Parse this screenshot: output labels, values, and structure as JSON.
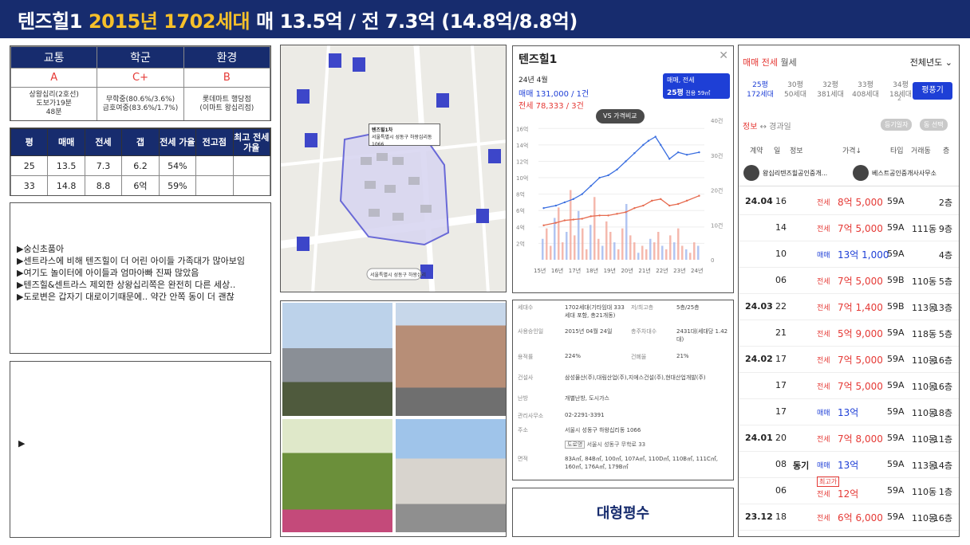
{
  "header": {
    "name": "텐즈힐1",
    "year_units": "2015년 1702세대",
    "prices": "매 13.5억 / 전 7.3억 (14.8억/8.8억)"
  },
  "location": {
    "headers": [
      "교통",
      "학군",
      "환경"
    ],
    "grades": [
      "A",
      "C+",
      "B"
    ],
    "details": [
      [
        "상왕십리(2호선)",
        "도보가19분",
        "48분"
      ],
      [
        "무학중(80.6%/3.6%)",
        "금호여중(83.6%/1.7%)"
      ],
      [
        "롯데마트 행당점",
        "(이마트 왕십리점)"
      ]
    ]
  },
  "price_table": {
    "headers": [
      "평",
      "매매",
      "전세",
      "갭",
      "전세 가율",
      "전고점",
      "최고 전세가율"
    ],
    "rows": [
      [
        "25",
        "13.5",
        "7.3",
        "6.2",
        "54%",
        "",
        ""
      ],
      [
        "33",
        "14.8",
        "8.8",
        "6억",
        "59%",
        "",
        ""
      ]
    ]
  },
  "notes": [
    "▶숭신초품아",
    "▶센트라스에 비해 텐즈힐이 더 어린 아이들 가족대가 많아보임",
    "▶여기도 놀이터에 아이들과 엄마아빠 진짜 많았음",
    "▶텐즈힐&센트라스 제외한 상왕십리쪽은 완전히 다른 세상..",
    "▶도로변은 갑자기 대로이기때문에.. 약간 안쪽 동이 더 괜찮"
  ],
  "notes2": [
    "▶"
  ],
  "map": {
    "callout_title": "텐즈힐1차",
    "callout_addr": "서울특별시 성동구 하왕십리동 1066",
    "footer": "서울특별시 성동구 하왕십리"
  },
  "chart_panel": {
    "title": "텐즈힐1",
    "date": "24년 4월",
    "sale_line": "매매 131,000 / 1건",
    "rent_line": "전세 78,333 / 3건",
    "toggle": "매매, 전세",
    "size_badge": "25평",
    "size_sub": "전용 59㎡",
    "compare_button": "VS 가격비교",
    "close_glyph": "✕"
  },
  "chart_data": {
    "type": "line",
    "x_ticks": [
      "15년",
      "16년",
      "17년",
      "18년",
      "19년",
      "20년",
      "21년",
      "22년",
      "23년",
      "24년"
    ],
    "y_left_ticks": [
      "16억",
      "14억",
      "12억",
      "10억",
      "8억",
      "6억",
      "4억",
      "2억"
    ],
    "y_right_ticks": [
      "40건",
      "30건",
      "20건",
      "10건",
      "0"
    ],
    "series": [
      {
        "name": "매매",
        "color": "#3b6fe0",
        "x": [
          2015.3,
          2016,
          2016.5,
          2017,
          2017.5,
          2018,
          2018.5,
          2019,
          2019.5,
          2020,
          2020.5,
          2021,
          2021.3,
          2021.7,
          2022,
          2022.5,
          2023,
          2023.5,
          2024.2
        ],
        "y": [
          6.3,
          6.6,
          7.0,
          7.4,
          8.0,
          9.0,
          10.0,
          10.3,
          11.0,
          12.0,
          13.0,
          14.0,
          14.5,
          15.0,
          14.0,
          12.3,
          13.1,
          12.8,
          13.1
        ]
      },
      {
        "name": "전세",
        "color": "#e66b4f",
        "x": [
          2015.3,
          2016,
          2016.5,
          2017,
          2017.5,
          2018,
          2018.5,
          2019,
          2019.5,
          2020,
          2020.5,
          2021,
          2021.5,
          2022,
          2022.5,
          2023,
          2023.5,
          2024.2
        ],
        "y": [
          4.2,
          4.5,
          4.8,
          4.9,
          5.0,
          5.3,
          5.4,
          5.4,
          5.6,
          5.8,
          6.3,
          6.6,
          7.2,
          7.4,
          6.6,
          6.8,
          7.2,
          7.8
        ]
      }
    ],
    "volume_bars": [
      6,
      9,
      4,
      12,
      15,
      5,
      8,
      20,
      7,
      14,
      9,
      3,
      10,
      18,
      6,
      4,
      11,
      8,
      5,
      3,
      9,
      16,
      7,
      5,
      2,
      4,
      3,
      6,
      5,
      8,
      4,
      3,
      7,
      5,
      9,
      4,
      3,
      2,
      5,
      4
    ],
    "ylim": [
      0,
      17
    ]
  },
  "info": {
    "rows": [
      {
        "k": "세대수",
        "v": "1702세대(기타임대 333세대 포함, 총21개동)",
        "k2": "저/최고층",
        "v2": "5층/25층"
      },
      {
        "k": "사용승인일",
        "v": "2015년 04월 24일",
        "k2": "총주차대수",
        "v2": "2431대(세대당 1.42대)"
      },
      {
        "k": "용적률",
        "v": "224%",
        "k2": "건폐율",
        "v2": "21%"
      },
      {
        "k": "건설사",
        "v": "삼성물산(주),대림산업(주),지에스건설(주),현대산업개발(주)",
        "k2": "",
        "v2": ""
      },
      {
        "k": "난방",
        "v": "개별난방, 도시가스",
        "k2": "",
        "v2": ""
      },
      {
        "k": "관리사무소",
        "v": "02-2291-3391",
        "k2": "",
        "v2": ""
      },
      {
        "k": "주소",
        "v": "서울시 성동구 하왕십리동 1066",
        "k2": "",
        "v2": ""
      },
      {
        "k": "면적",
        "v": "83A㎡, 84B㎡, 100㎡, 107A㎡, 110D㎡, 110B㎡, 111C㎡, 160㎡, 176A㎡, 179B㎡",
        "k2": "",
        "v2": ""
      }
    ],
    "road_badge": "도로명",
    "road_addr": "서울시 성동구 무학로 33"
  },
  "big_label": "대형평수",
  "trades": {
    "tabs": [
      "매매",
      "전세",
      "월세"
    ],
    "year_filter": "전체년도",
    "sizes": [
      {
        "p": "25평",
        "u": "172세대"
      },
      {
        "p": "30평",
        "u": "50세대"
      },
      {
        "p": "32평",
        "u": "381세대"
      },
      {
        "p": "33평",
        "u": "408세대"
      },
      {
        "p": "34평",
        "u": "18세대"
      }
    ],
    "sizes_extra": "2",
    "floor_button": "평풍기",
    "info_label": "정보",
    "arrow_label": "↔ 경과일",
    "chip1": "등기일자",
    "chip2": "동 선택",
    "col_headers": [
      "계약",
      "일",
      "정보",
      "가격↓",
      "타입",
      "거래동",
      "층"
    ],
    "agents": [
      "왕십리텐즈힐공인중개...",
      "베스트공인중개사사무소"
    ],
    "rows": [
      {
        "ym": "24.04",
        "d": "16",
        "kind": "전세",
        "price": "8억 5,000",
        "type": "59A",
        "dong": "",
        "fl": "2층",
        "cls": "red"
      },
      {
        "ym": "",
        "d": "14",
        "kind": "전세",
        "price": "7억 5,000",
        "type": "59A",
        "dong": "111동",
        "fl": "9층",
        "cls": "red"
      },
      {
        "ym": "",
        "d": "10",
        "kind": "매매",
        "price": "13억 1,000",
        "type": "59A",
        "dong": "",
        "fl": "4층",
        "cls": "blue"
      },
      {
        "ym": "",
        "d": "06",
        "kind": "전세",
        "price": "7억 5,000",
        "type": "59B",
        "dong": "110동",
        "fl": "5층",
        "cls": "red"
      },
      {
        "ym": "24.03",
        "d": "22",
        "kind": "전세",
        "price": "7억 1,400",
        "type": "59B",
        "dong": "113동",
        "fl": "13층",
        "cls": "red"
      },
      {
        "ym": "",
        "d": "21",
        "kind": "전세",
        "price": "5억 9,000",
        "type": "59A",
        "dong": "118동",
        "fl": "5층",
        "cls": "red"
      },
      {
        "ym": "24.02",
        "d": "17",
        "kind": "전세",
        "price": "7억 5,000",
        "type": "59A",
        "dong": "110동",
        "fl": "16층",
        "cls": "red"
      },
      {
        "ym": "",
        "d": "17",
        "kind": "전세",
        "price": "7억 5,000",
        "type": "59A",
        "dong": "110동",
        "fl": "16층",
        "cls": "red"
      },
      {
        "ym": "",
        "d": "17",
        "kind": "매매",
        "price": "13억",
        "type": "59A",
        "dong": "110동",
        "fl": "18층",
        "cls": "blue"
      },
      {
        "ym": "24.01",
        "d": "20",
        "kind": "전세",
        "price": "7억 8,000",
        "type": "59A",
        "dong": "110동",
        "fl": "11층",
        "cls": "red"
      },
      {
        "ym": "",
        "d": "08",
        "kind": "매매",
        "price": "13억",
        "type": "59A",
        "dong": "113동",
        "fl": "14층",
        "cls": "blue",
        "tag": "동기"
      },
      {
        "ym": "",
        "d": "06",
        "kind": "전세",
        "price": "12억",
        "type": "59A",
        "dong": "110동",
        "fl": "1층",
        "cls": "red",
        "badge": "최고가"
      },
      {
        "ym": "23.12",
        "d": "18",
        "kind": "전세",
        "price": "6억 6,000",
        "type": "59A",
        "dong": "110동",
        "fl": "16층",
        "cls": "red"
      }
    ]
  }
}
